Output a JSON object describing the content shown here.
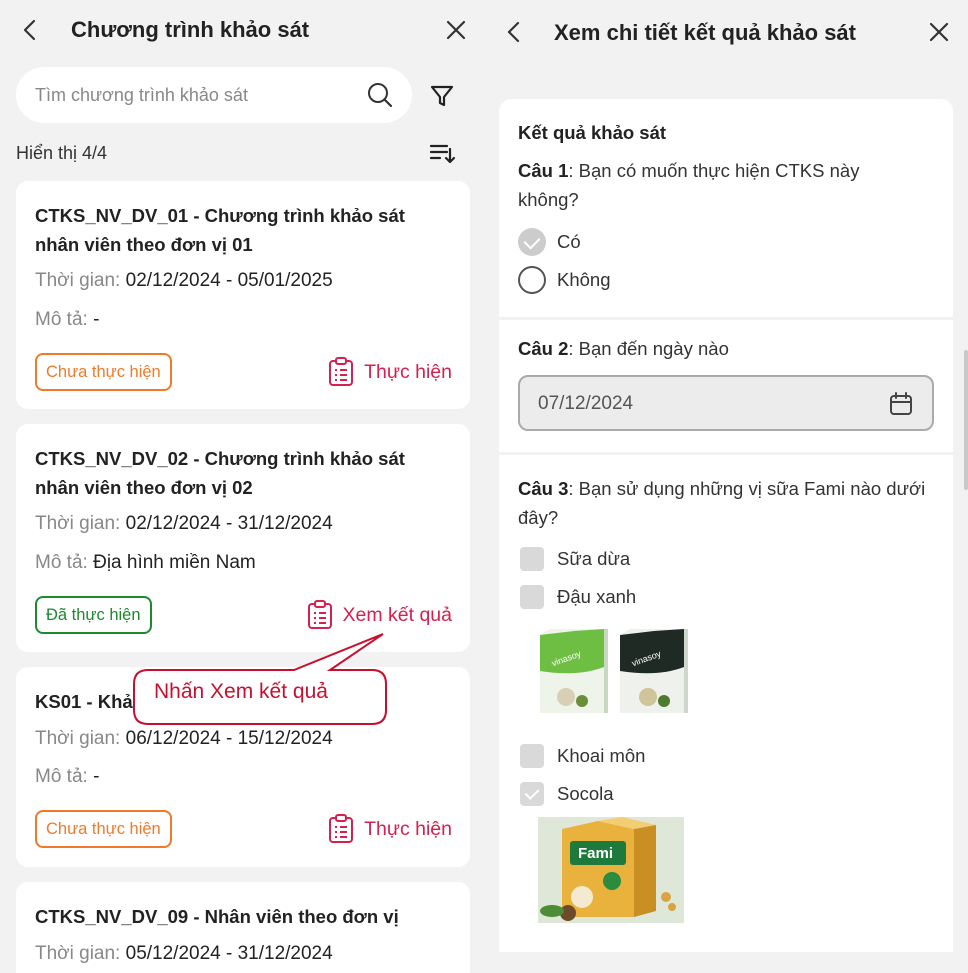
{
  "left": {
    "title": "Chương trình khảo sát",
    "search_placeholder": "Tìm chương trình khảo sát",
    "count_text": "Hiển thị 4/4",
    "labels": {
      "time": "Thời gian:",
      "desc": "Mô tả:"
    },
    "cards": [
      {
        "title": "CTKS_NV_DV_01 - Chương trình khảo sát nhân viên theo đơn vị 01",
        "time": "02/12/2024 - 05/01/2025",
        "desc": "-",
        "status": "Chưa thực hiện",
        "action": "Thực hiện"
      },
      {
        "title": "CTKS_NV_DV_02 - Chương trình khảo sát nhân viên theo đơn vị 02",
        "time": "02/12/2024 - 31/12/2024",
        "desc": "Địa hình miền Nam",
        "status": "Đã thực hiện",
        "action": "Xem kết quả"
      },
      {
        "title": "KS01 - Khảo sát",
        "time": "06/12/2024 - 15/12/2024",
        "desc": "-",
        "status": "Chưa thực hiện",
        "action": "Thực hiện"
      },
      {
        "title": "CTKS_NV_DV_09 - Nhân viên theo đơn vị",
        "time": "05/12/2024 - 31/12/2024"
      }
    ],
    "callout": "Nhấn Xem kết quả",
    "colors": {
      "pending": "#f07a2a",
      "done": "#1d8a2f",
      "action": "#d6204e",
      "callout": "#c8102e"
    }
  },
  "right": {
    "title": "Xem chi tiết kết quả khảo sát",
    "section_title": "Kết quả khảo sát",
    "q1": {
      "num": "Câu 1",
      "text": ": Bạn có muốn thực hiện CTKS này không?",
      "options": [
        {
          "label": "Có",
          "selected": true
        },
        {
          "label": "Không",
          "selected": false
        }
      ]
    },
    "q2": {
      "num": "Câu 2",
      "text": ": Bạn đến ngày nào",
      "value": "07/12/2024"
    },
    "q3": {
      "num": "Câu 3",
      "text": ": Bạn sử dụng những vị sữa Fami nào dưới đây?",
      "options": [
        {
          "label": "Sữa dừa",
          "checked": false
        },
        {
          "label": "Đậu xanh",
          "checked": false
        },
        {
          "label": "Khoai môn",
          "checked": false
        },
        {
          "label": "Socola",
          "checked": true
        }
      ],
      "brand_green": "vinasoy",
      "brand_dark": "vinasoy",
      "brand_box": "Fami"
    }
  }
}
